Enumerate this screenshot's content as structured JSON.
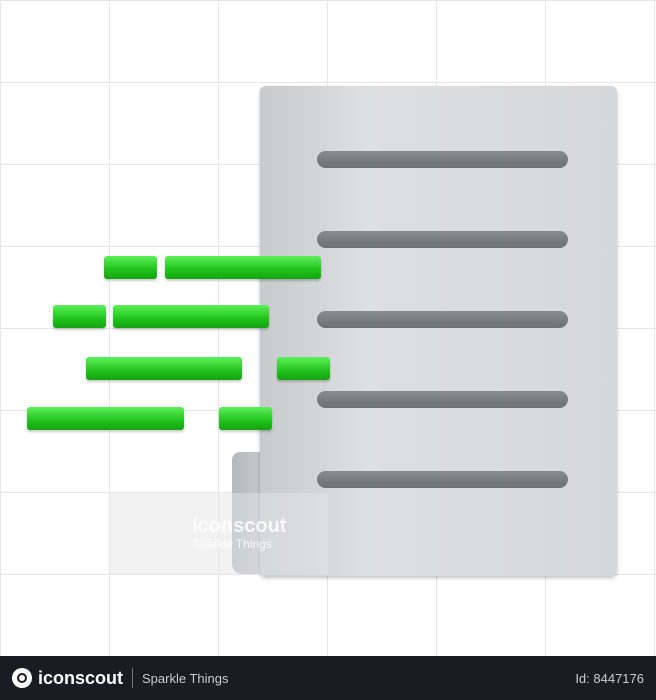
{
  "watermark": {
    "brand": "iconscout",
    "subtitle": "Sparkle Things"
  },
  "footer": {
    "brand": "iconscout",
    "author": "Sparkle Things",
    "id": "Id: 8447176"
  },
  "colors": {
    "accent": "#21c21d",
    "doc": "#d6d7d9",
    "footer": "#1b1c23"
  }
}
